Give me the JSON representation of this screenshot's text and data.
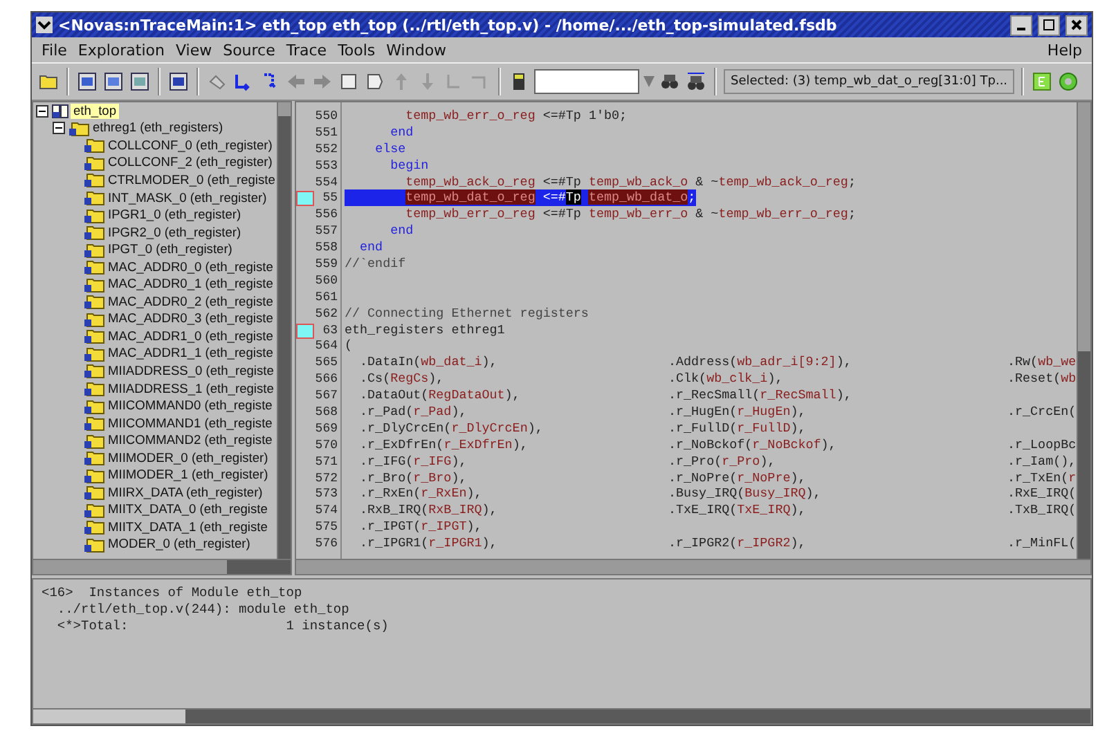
{
  "window": {
    "title": "<Novas:nTraceMain:1> eth_top eth_top (../rtl/eth_top.v) - /home/.../eth_top-simulated.fsdb"
  },
  "menu": [
    {
      "label": "File"
    },
    {
      "label": "Exploration"
    },
    {
      "label": "View"
    },
    {
      "label": "Source"
    },
    {
      "label": "Trace"
    },
    {
      "label": "Tools"
    },
    {
      "label": "Window"
    },
    {
      "label": "Help"
    }
  ],
  "toolbar": {
    "selected_label": "Selected: (3) temp_wb_dat_o_reg[31:0] Tp..."
  },
  "tree": [
    {
      "label": "eth_top",
      "selected": true,
      "expanded": true,
      "kind": "module",
      "children": [
        {
          "label": "ethreg1 (eth_registers)",
          "selected": false,
          "expanded": true,
          "kind": "instance",
          "children": [
            {
              "label": "COLLCONF_0 (eth_register)",
              "selected": false,
              "kind": "instance"
            },
            {
              "label": "COLLCONF_2 (eth_register)",
              "selected": false,
              "kind": "instance"
            },
            {
              "label": "CTRLMODER_0 (eth_registe",
              "selected": false,
              "kind": "instance"
            },
            {
              "label": "INT_MASK_0 (eth_register)",
              "selected": false,
              "kind": "instance"
            },
            {
              "label": "IPGR1_0 (eth_register)",
              "selected": false,
              "kind": "instance"
            },
            {
              "label": "IPGR2_0 (eth_register)",
              "selected": false,
              "kind": "instance"
            },
            {
              "label": "IPGT_0 (eth_register)",
              "selected": false,
              "kind": "instance"
            },
            {
              "label": "MAC_ADDR0_0 (eth_registe",
              "selected": false,
              "kind": "instance"
            },
            {
              "label": "MAC_ADDR0_1 (eth_registe",
              "selected": false,
              "kind": "instance"
            },
            {
              "label": "MAC_ADDR0_2 (eth_registe",
              "selected": false,
              "kind": "instance"
            },
            {
              "label": "MAC_ADDR0_3 (eth_registe",
              "selected": false,
              "kind": "instance"
            },
            {
              "label": "MAC_ADDR1_0 (eth_registe",
              "selected": false,
              "kind": "instance"
            },
            {
              "label": "MAC_ADDR1_1 (eth_registe",
              "selected": false,
              "kind": "instance"
            },
            {
              "label": "MIIADDRESS_0 (eth_registe",
              "selected": false,
              "kind": "instance"
            },
            {
              "label": "MIIADDRESS_1 (eth_registe",
              "selected": false,
              "kind": "instance"
            },
            {
              "label": "MIICOMMAND0 (eth_registe",
              "selected": false,
              "kind": "instance"
            },
            {
              "label": "MIICOMMAND1 (eth_registe",
              "selected": false,
              "kind": "instance"
            },
            {
              "label": "MIICOMMAND2 (eth_registe",
              "selected": false,
              "kind": "instance"
            },
            {
              "label": "MIIMODER_0 (eth_register)",
              "selected": false,
              "kind": "instance"
            },
            {
              "label": "MIIMODER_1 (eth_register)",
              "selected": false,
              "kind": "instance"
            },
            {
              "label": "MIIRX_DATA (eth_register)",
              "selected": false,
              "kind": "instance"
            },
            {
              "label": "MIITX_DATA_0 (eth_registe",
              "selected": false,
              "kind": "instance"
            },
            {
              "label": "MIITX_DATA_1 (eth_registe",
              "selected": false,
              "kind": "instance"
            },
            {
              "label": "MODER_0 (eth_register)",
              "selected": false,
              "kind": "instance"
            }
          ]
        }
      ]
    }
  ],
  "code": [
    {
      "number": "550",
      "marker": false,
      "selected": false,
      "columns": [
        [
          {
            "kind": "plain",
            "text": "        "
          },
          {
            "kind": "signal",
            "text": "temp_wb_err_o_reg"
          },
          {
            "kind": "plain",
            "text": " <=#Tp 1'b0;"
          }
        ]
      ]
    },
    {
      "number": "551",
      "marker": false,
      "selected": false,
      "columns": [
        [
          {
            "kind": "plain",
            "text": "      "
          },
          {
            "kind": "keyword",
            "text": "end"
          }
        ]
      ]
    },
    {
      "number": "552",
      "marker": false,
      "selected": false,
      "columns": [
        [
          {
            "kind": "plain",
            "text": "    "
          },
          {
            "kind": "keyword",
            "text": "else"
          }
        ]
      ]
    },
    {
      "number": "553",
      "marker": false,
      "selected": false,
      "columns": [
        [
          {
            "kind": "plain",
            "text": "      "
          },
          {
            "kind": "keyword",
            "text": "begin"
          }
        ]
      ]
    },
    {
      "number": "554",
      "marker": false,
      "selected": false,
      "columns": [
        [
          {
            "kind": "plain",
            "text": "        "
          },
          {
            "kind": "signal",
            "text": "temp_wb_ack_o_reg"
          },
          {
            "kind": "plain",
            "text": " <=#Tp "
          },
          {
            "kind": "signal",
            "text": "temp_wb_ack_o"
          },
          {
            "kind": "plain",
            "text": " & ~"
          },
          {
            "kind": "signal",
            "text": "temp_wb_ack_o_reg"
          },
          {
            "kind": "plain",
            "text": ";"
          }
        ]
      ]
    },
    {
      "number": "55",
      "marker": true,
      "selected": true,
      "columns": [
        [
          {
            "kind": "plain",
            "text": "        "
          },
          {
            "kind": "signal",
            "text": "temp_wb_dat_o_reg"
          },
          {
            "kind": "plain",
            "text": " <=#"
          },
          {
            "kind": "cursor",
            "text": "Tp"
          },
          {
            "kind": "plain",
            "text": " "
          },
          {
            "kind": "signal",
            "text": "temp_wb_dat_o"
          },
          {
            "kind": "plain",
            "text": ";"
          }
        ]
      ]
    },
    {
      "number": "556",
      "marker": false,
      "selected": false,
      "columns": [
        [
          {
            "kind": "plain",
            "text": "        "
          },
          {
            "kind": "signal",
            "text": "temp_wb_err_o_reg"
          },
          {
            "kind": "plain",
            "text": " <=#Tp "
          },
          {
            "kind": "signal",
            "text": "temp_wb_err_o"
          },
          {
            "kind": "plain",
            "text": " & ~"
          },
          {
            "kind": "signal",
            "text": "temp_wb_err_o_reg"
          },
          {
            "kind": "plain",
            "text": ";"
          }
        ]
      ]
    },
    {
      "number": "557",
      "marker": false,
      "selected": false,
      "columns": [
        [
          {
            "kind": "plain",
            "text": "      "
          },
          {
            "kind": "keyword",
            "text": "end"
          }
        ]
      ]
    },
    {
      "number": "558",
      "marker": false,
      "selected": false,
      "columns": [
        [
          {
            "kind": "plain",
            "text": "  "
          },
          {
            "kind": "keyword",
            "text": "end"
          }
        ]
      ]
    },
    {
      "number": "559",
      "marker": false,
      "selected": false,
      "columns": [
        [
          {
            "kind": "comment",
            "text": "//`endif"
          }
        ]
      ]
    },
    {
      "number": "560",
      "marker": false,
      "selected": false
    },
    {
      "number": "561",
      "marker": false,
      "selected": false
    },
    {
      "number": "562",
      "marker": false,
      "selected": false,
      "columns": [
        [
          {
            "kind": "comment",
            "text": "// Connecting Ethernet registers"
          }
        ]
      ]
    },
    {
      "number": "63",
      "marker": true,
      "selected": false,
      "columns": [
        [
          {
            "kind": "plain",
            "text": "eth_registers ethreg1"
          }
        ]
      ]
    },
    {
      "number": "564",
      "marker": false,
      "selected": false,
      "columns": [
        [
          {
            "kind": "plain",
            "text": "("
          }
        ]
      ]
    },
    {
      "number": "565",
      "marker": false,
      "selected": false,
      "columns": [
        [
          {
            "kind": "plain",
            "text": "  .DataIn("
          },
          {
            "kind": "signal",
            "text": "wb_dat_i"
          },
          {
            "kind": "plain",
            "text": "),"
          }
        ],
        [
          {
            "kind": "plain",
            "text": ".Address("
          },
          {
            "kind": "signal",
            "text": "wb_adr_i[9:2]"
          },
          {
            "kind": "plain",
            "text": "),"
          }
        ],
        [
          {
            "kind": "plain",
            "text": ".Rw("
          },
          {
            "kind": "signal",
            "text": "wb_we"
          }
        ]
      ]
    },
    {
      "number": "566",
      "marker": false,
      "selected": false,
      "columns": [
        [
          {
            "kind": "plain",
            "text": "  .Cs("
          },
          {
            "kind": "signal",
            "text": "RegCs"
          },
          {
            "kind": "plain",
            "text": "),"
          }
        ],
        [
          {
            "kind": "plain",
            "text": ".Clk("
          },
          {
            "kind": "signal",
            "text": "wb_clk_i"
          },
          {
            "kind": "plain",
            "text": "),"
          }
        ],
        [
          {
            "kind": "plain",
            "text": ".Reset("
          },
          {
            "kind": "signal",
            "text": "wb"
          }
        ]
      ]
    },
    {
      "number": "567",
      "marker": false,
      "selected": false,
      "columns": [
        [
          {
            "kind": "plain",
            "text": "  .DataOut("
          },
          {
            "kind": "signal",
            "text": "RegDataOut"
          },
          {
            "kind": "plain",
            "text": "),"
          }
        ],
        [
          {
            "kind": "plain",
            "text": ".r_RecSmall("
          },
          {
            "kind": "signal",
            "text": "r_RecSmall"
          },
          {
            "kind": "plain",
            "text": "),"
          }
        ]
      ]
    },
    {
      "number": "568",
      "marker": false,
      "selected": false,
      "columns": [
        [
          {
            "kind": "plain",
            "text": "  .r_Pad("
          },
          {
            "kind": "signal",
            "text": "r_Pad"
          },
          {
            "kind": "plain",
            "text": "),"
          }
        ],
        [
          {
            "kind": "plain",
            "text": ".r_HugEn("
          },
          {
            "kind": "signal",
            "text": "r_HugEn"
          },
          {
            "kind": "plain",
            "text": "),"
          }
        ],
        [
          {
            "kind": "plain",
            "text": ".r_CrcEn("
          }
        ]
      ]
    },
    {
      "number": "569",
      "marker": false,
      "selected": false,
      "columns": [
        [
          {
            "kind": "plain",
            "text": "  .r_DlyCrcEn("
          },
          {
            "kind": "signal",
            "text": "r_DlyCrcEn"
          },
          {
            "kind": "plain",
            "text": "),"
          }
        ],
        [
          {
            "kind": "plain",
            "text": ".r_FullD("
          },
          {
            "kind": "signal",
            "text": "r_FullD"
          },
          {
            "kind": "plain",
            "text": "),"
          }
        ]
      ]
    },
    {
      "number": "570",
      "marker": false,
      "selected": false,
      "columns": [
        [
          {
            "kind": "plain",
            "text": "  .r_ExDfrEn("
          },
          {
            "kind": "signal",
            "text": "r_ExDfrEn"
          },
          {
            "kind": "plain",
            "text": "),"
          }
        ],
        [
          {
            "kind": "plain",
            "text": ".r_NoBckof("
          },
          {
            "kind": "signal",
            "text": "r_NoBckof"
          },
          {
            "kind": "plain",
            "text": "),"
          }
        ],
        [
          {
            "kind": "plain",
            "text": ".r_LoopBc"
          }
        ]
      ]
    },
    {
      "number": "571",
      "marker": false,
      "selected": false,
      "columns": [
        [
          {
            "kind": "plain",
            "text": "  .r_IFG("
          },
          {
            "kind": "signal",
            "text": "r_IFG"
          },
          {
            "kind": "plain",
            "text": "),"
          }
        ],
        [
          {
            "kind": "plain",
            "text": ".r_Pro("
          },
          {
            "kind": "signal",
            "text": "r_Pro"
          },
          {
            "kind": "plain",
            "text": "),"
          }
        ],
        [
          {
            "kind": "plain",
            "text": ".r_Iam(),"
          }
        ]
      ]
    },
    {
      "number": "572",
      "marker": false,
      "selected": false,
      "columns": [
        [
          {
            "kind": "plain",
            "text": "  .r_Bro("
          },
          {
            "kind": "signal",
            "text": "r_Bro"
          },
          {
            "kind": "plain",
            "text": "),"
          }
        ],
        [
          {
            "kind": "plain",
            "text": ".r_NoPre("
          },
          {
            "kind": "signal",
            "text": "r_NoPre"
          },
          {
            "kind": "plain",
            "text": "),"
          }
        ],
        [
          {
            "kind": "plain",
            "text": ".r_TxEn("
          },
          {
            "kind": "signal",
            "text": "r"
          }
        ]
      ]
    },
    {
      "number": "573",
      "marker": false,
      "selected": false,
      "columns": [
        [
          {
            "kind": "plain",
            "text": "  .r_RxEn("
          },
          {
            "kind": "signal",
            "text": "r_RxEn"
          },
          {
            "kind": "plain",
            "text": "),"
          }
        ],
        [
          {
            "kind": "plain",
            "text": ".Busy_IRQ("
          },
          {
            "kind": "signal",
            "text": "Busy_IRQ"
          },
          {
            "kind": "plain",
            "text": "),"
          }
        ],
        [
          {
            "kind": "plain",
            "text": ".RxE_IRQ("
          }
        ]
      ]
    },
    {
      "number": "574",
      "marker": false,
      "selected": false,
      "columns": [
        [
          {
            "kind": "plain",
            "text": "  .RxB_IRQ("
          },
          {
            "kind": "signal",
            "text": "RxB_IRQ"
          },
          {
            "kind": "plain",
            "text": "),"
          }
        ],
        [
          {
            "kind": "plain",
            "text": ".TxE_IRQ("
          },
          {
            "kind": "signal",
            "text": "TxE_IRQ"
          },
          {
            "kind": "plain",
            "text": "),"
          }
        ],
        [
          {
            "kind": "plain",
            "text": ".TxB_IRQ("
          }
        ]
      ]
    },
    {
      "number": "575",
      "marker": false,
      "selected": false,
      "columns": [
        [
          {
            "kind": "plain",
            "text": "  .r_IPGT("
          },
          {
            "kind": "signal",
            "text": "r_IPGT"
          },
          {
            "kind": "plain",
            "text": "),"
          }
        ]
      ]
    },
    {
      "number": "576",
      "marker": false,
      "selected": false,
      "columns": [
        [
          {
            "kind": "plain",
            "text": "  .r_IPGR1("
          },
          {
            "kind": "signal",
            "text": "r_IPGR1"
          },
          {
            "kind": "plain",
            "text": "),"
          }
        ],
        [
          {
            "kind": "plain",
            "text": ".r_IPGR2("
          },
          {
            "kind": "signal",
            "text": "r_IPGR2"
          },
          {
            "kind": "plain",
            "text": "),"
          }
        ],
        [
          {
            "kind": "plain",
            "text": ".r_MinFL("
          }
        ]
      ]
    }
  ],
  "console": [
    {
      "prompt": "<16>",
      "text": "Instances of Module eth_top"
    },
    {
      "text": "  ../rtl/eth_top.v(244): module eth_top"
    },
    {
      "text": "  <*>Total:                    1 instance(s)"
    }
  ]
}
